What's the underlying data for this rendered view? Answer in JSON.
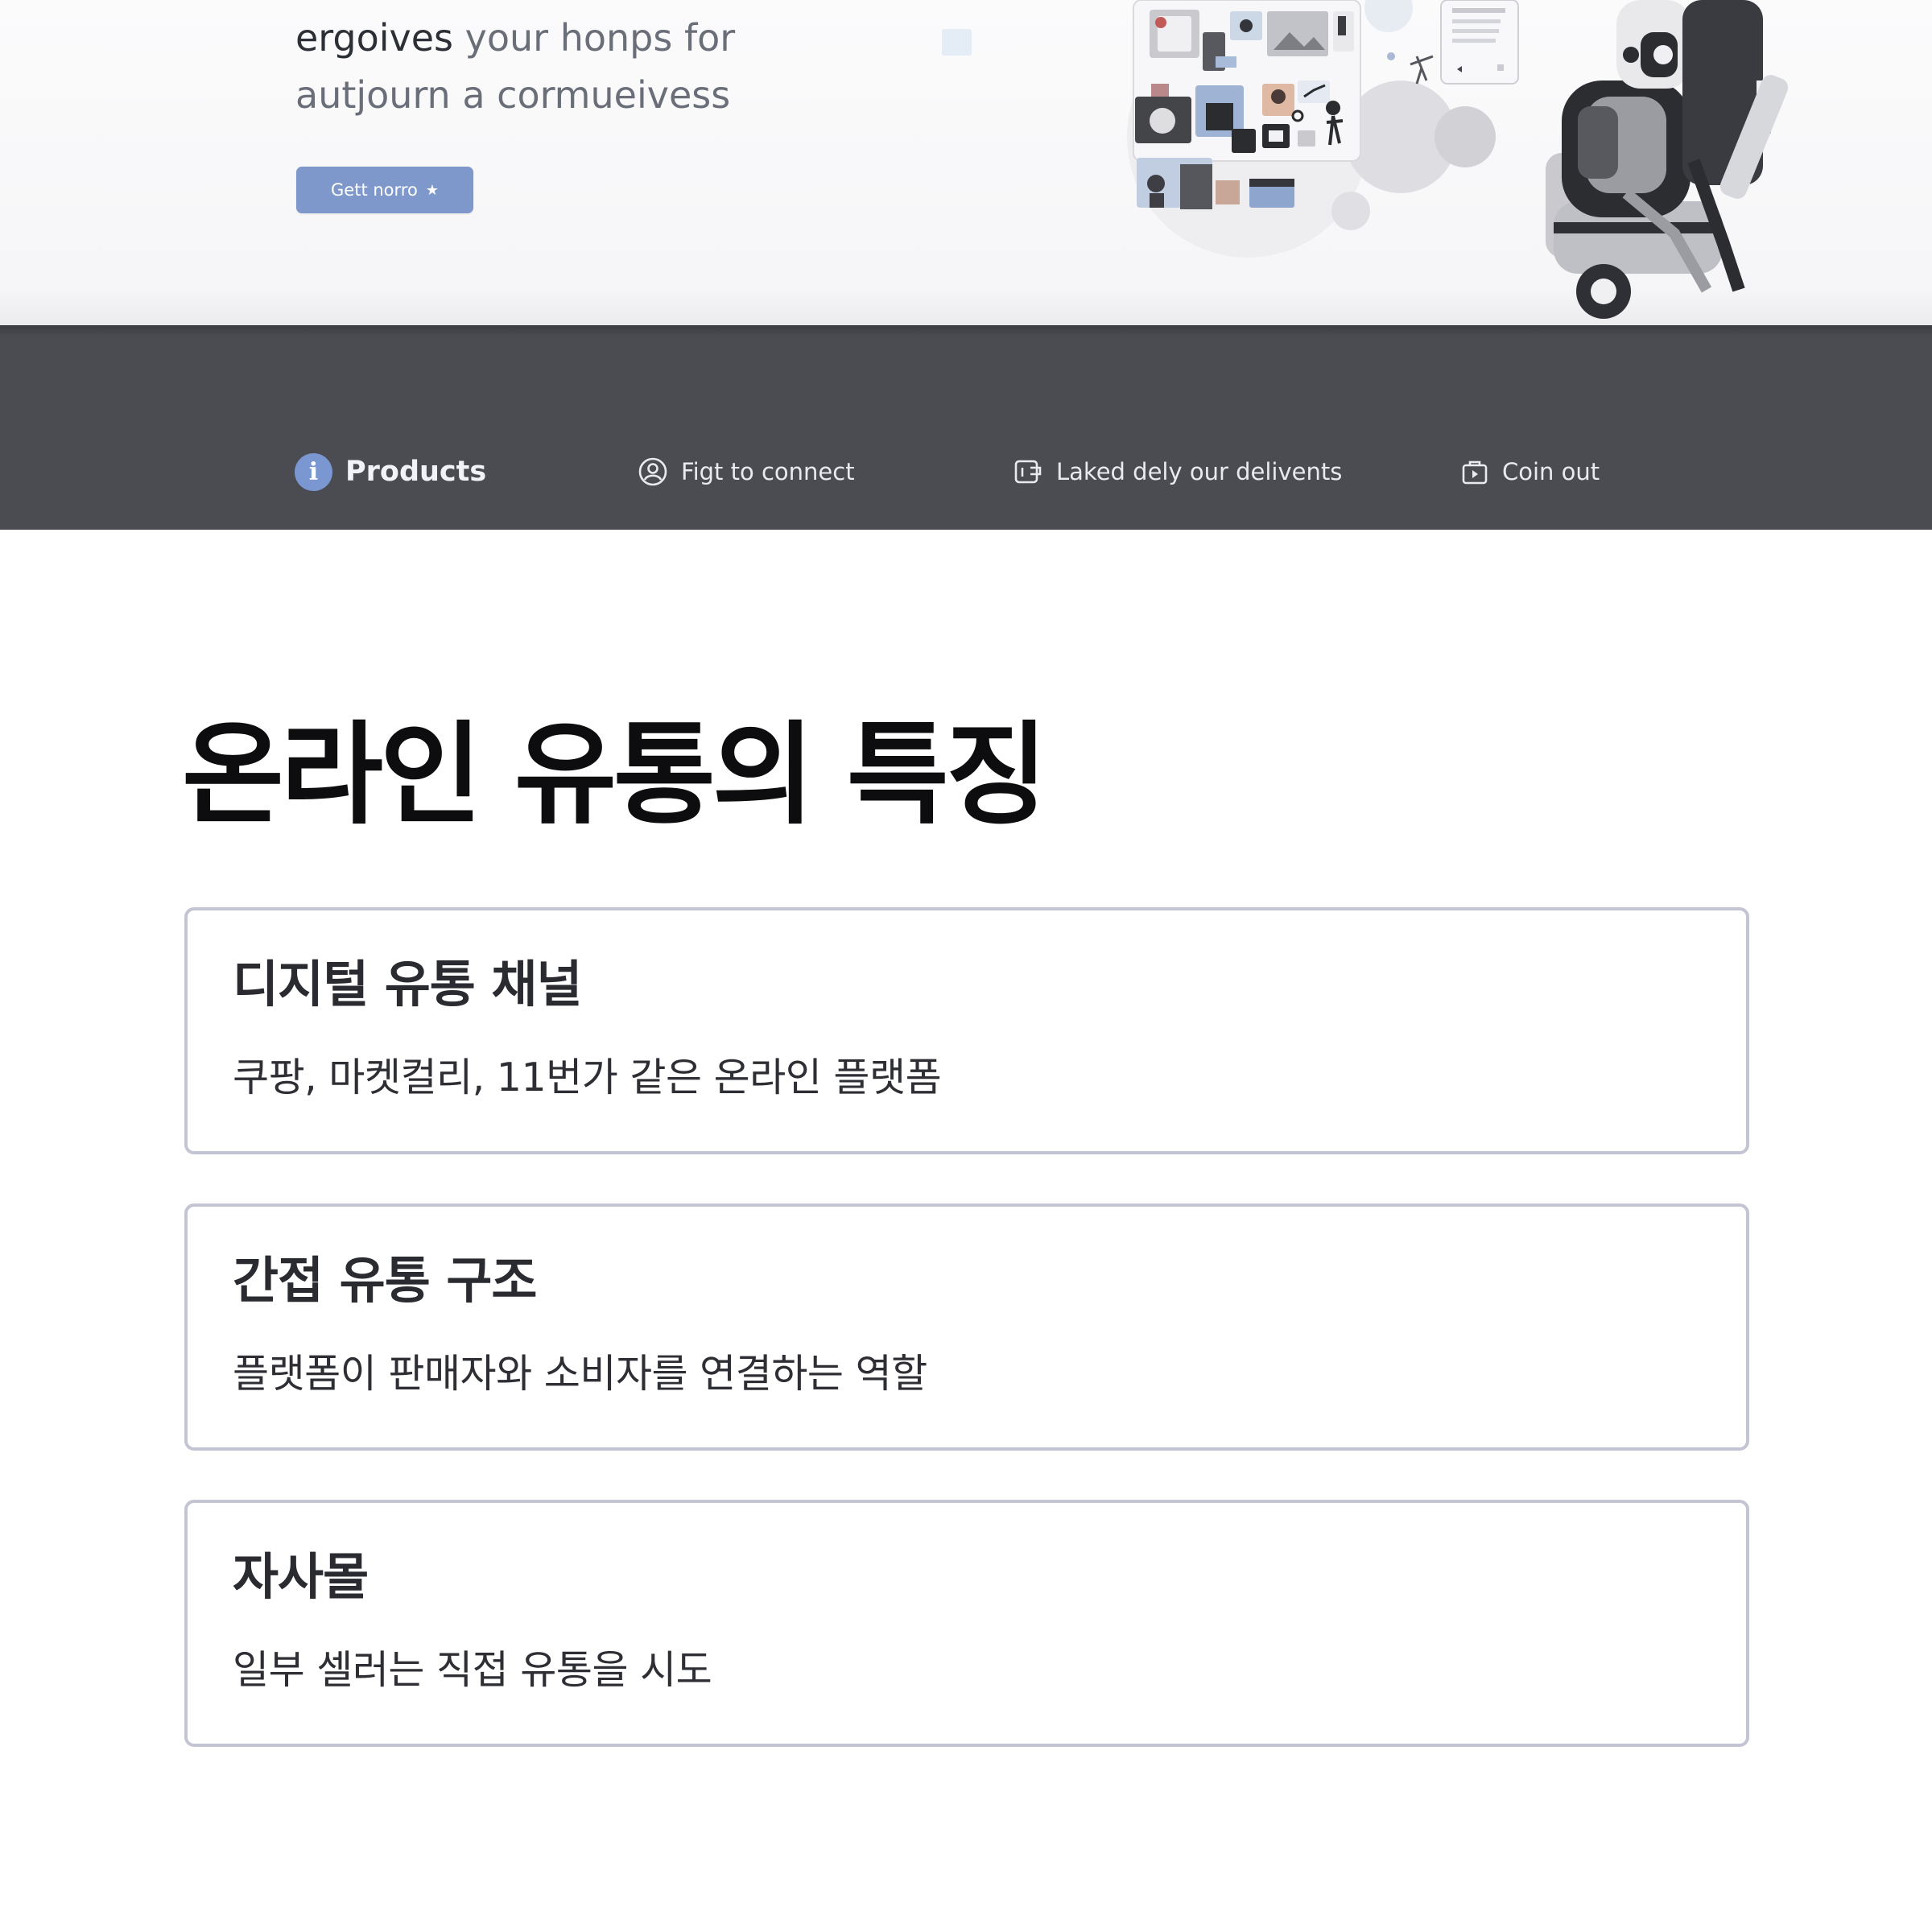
{
  "hero": {
    "line1_strong": "ergoives",
    "line1_rest": " your honps for",
    "line2": "autjourn a cormueivess",
    "cta_label": "Gett norro",
    "cta_icon": "star-icon"
  },
  "nav": {
    "items": [
      {
        "label": "Products",
        "icon": "info-icon",
        "active": true
      },
      {
        "label": "Figt to connect",
        "icon": "user-circle-icon"
      },
      {
        "label": "Laked dely our delivents",
        "icon": "delivery-icon"
      },
      {
        "label": "Coin out",
        "icon": "bag-icon"
      }
    ]
  },
  "main": {
    "title": "온라인 유통의 특징",
    "cards": [
      {
        "title": "디지털 유통 채널",
        "description": "쿠팡, 마켓컬리, 11번가 같은 온라인 플랫폼"
      },
      {
        "title": "간접 유통 구조",
        "description": "플랫폼이 판매자와 소비자를 연결하는 역할"
      },
      {
        "title": "자사몰",
        "description": "일부 셀러는 직접 유통을 시도"
      }
    ]
  },
  "colors": {
    "nav_background": "#4b4c52",
    "accent": "#7f98cb",
    "card_border": "#c3c4d4",
    "title_text": "#0d0d0f"
  }
}
